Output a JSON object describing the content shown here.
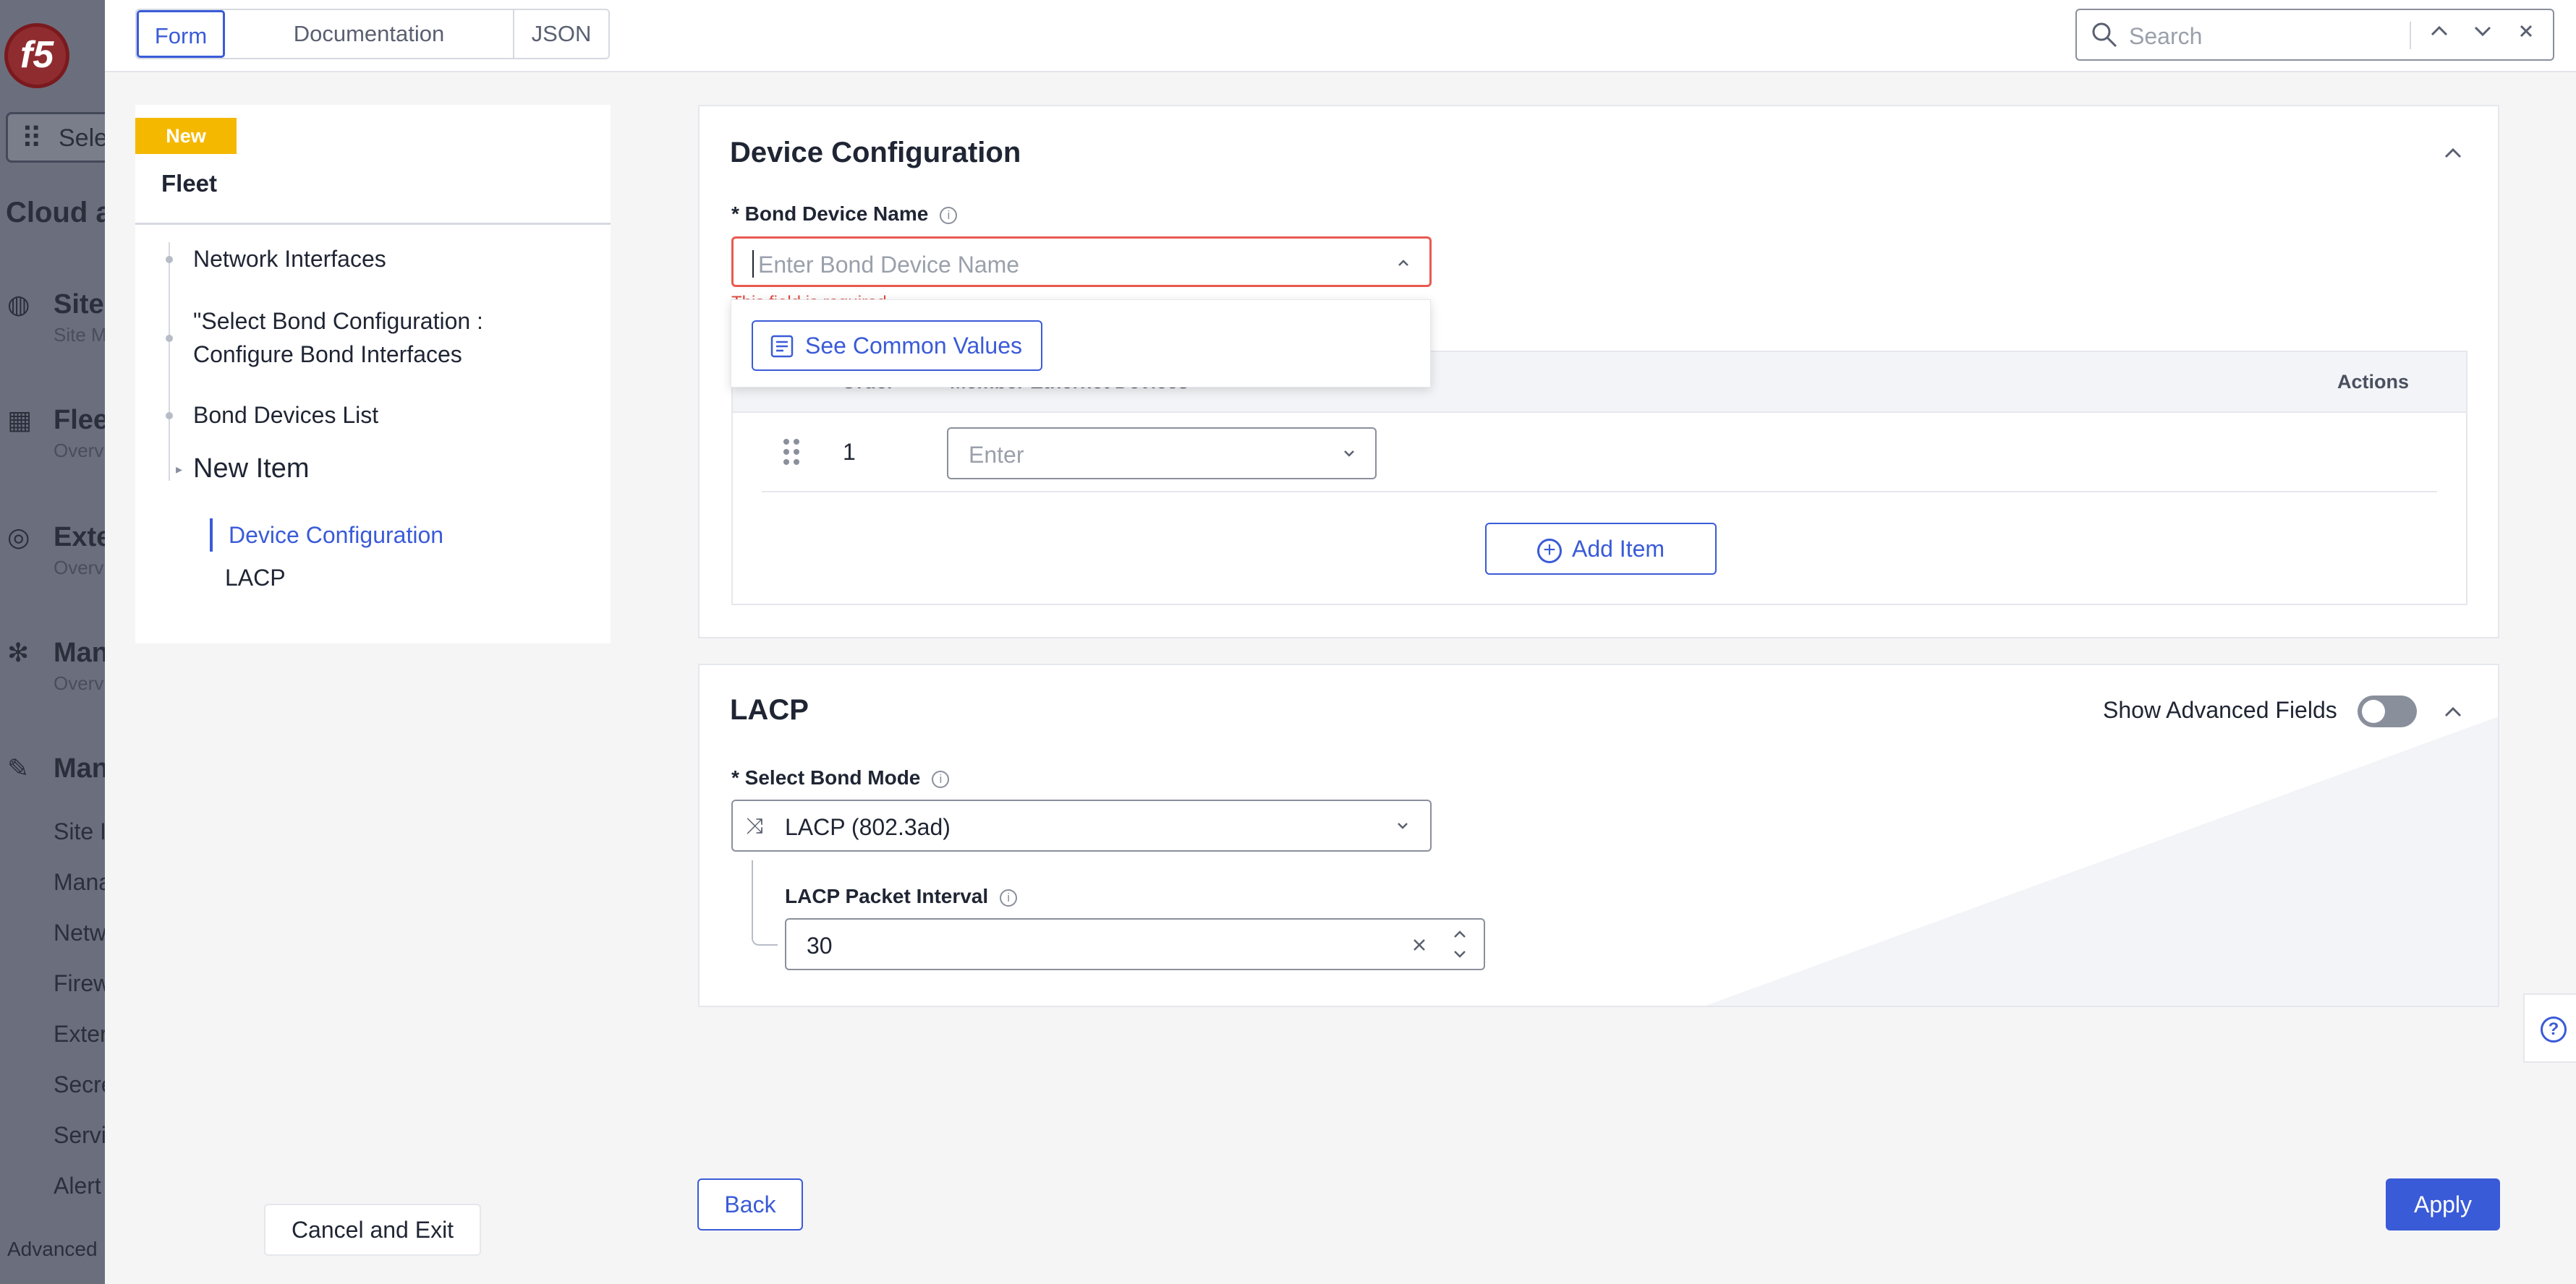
{
  "leftnav": {
    "logo": "f5",
    "select_label": "Sele",
    "title": "Cloud a",
    "items": [
      {
        "label": "Sites",
        "sub": "Site M"
      },
      {
        "label": "Flee",
        "sub": "Overv"
      },
      {
        "label": "Exte",
        "sub": "Overv"
      },
      {
        "label": "Man",
        "sub": "Overv"
      },
      {
        "label": "Man",
        "sub": ""
      }
    ],
    "subitems": [
      "Site I",
      "Mana",
      "Netw",
      "Firew",
      "Exter",
      "Secre",
      "Servi",
      "Alert"
    ],
    "advanced": "Advanced"
  },
  "topbar": {
    "tabs": [
      "Form",
      "Documentation",
      "JSON"
    ],
    "search_placeholder": "Search"
  },
  "toc": {
    "badge": "New",
    "heading": "Fleet",
    "items": [
      "Network Interfaces",
      "\"Select Bond Configuration : Configure Bond Interfaces",
      "Bond Devices List",
      "New Item"
    ],
    "sub_active": "Device Configuration",
    "sub_other": "LACP"
  },
  "device_config": {
    "title": "Device Configuration",
    "bond_name_label": "* Bond Device Name",
    "bond_name_placeholder": "Enter Bond Device Name",
    "error": "This field is required",
    "see_common_values": "See Common Values",
    "table": {
      "headers": [
        "Order",
        "Member Ethernet Devices",
        "Actions"
      ],
      "rows": [
        {
          "order": "1",
          "placeholder": "Enter"
        }
      ]
    },
    "add_item": "Add Item"
  },
  "lacp": {
    "title": "LACP",
    "show_advanced": "Show Advanced Fields",
    "bond_mode_label": "* Select Bond Mode",
    "bond_mode_value": "LACP (802.3ad)",
    "packet_interval_label": "LACP Packet Interval",
    "packet_interval_value": "30"
  },
  "footer": {
    "cancel": "Cancel and Exit",
    "back": "Back",
    "apply": "Apply"
  },
  "colors": {
    "accent": "#3a5bd8",
    "error": "#e85a50",
    "badge": "#f5b800"
  }
}
